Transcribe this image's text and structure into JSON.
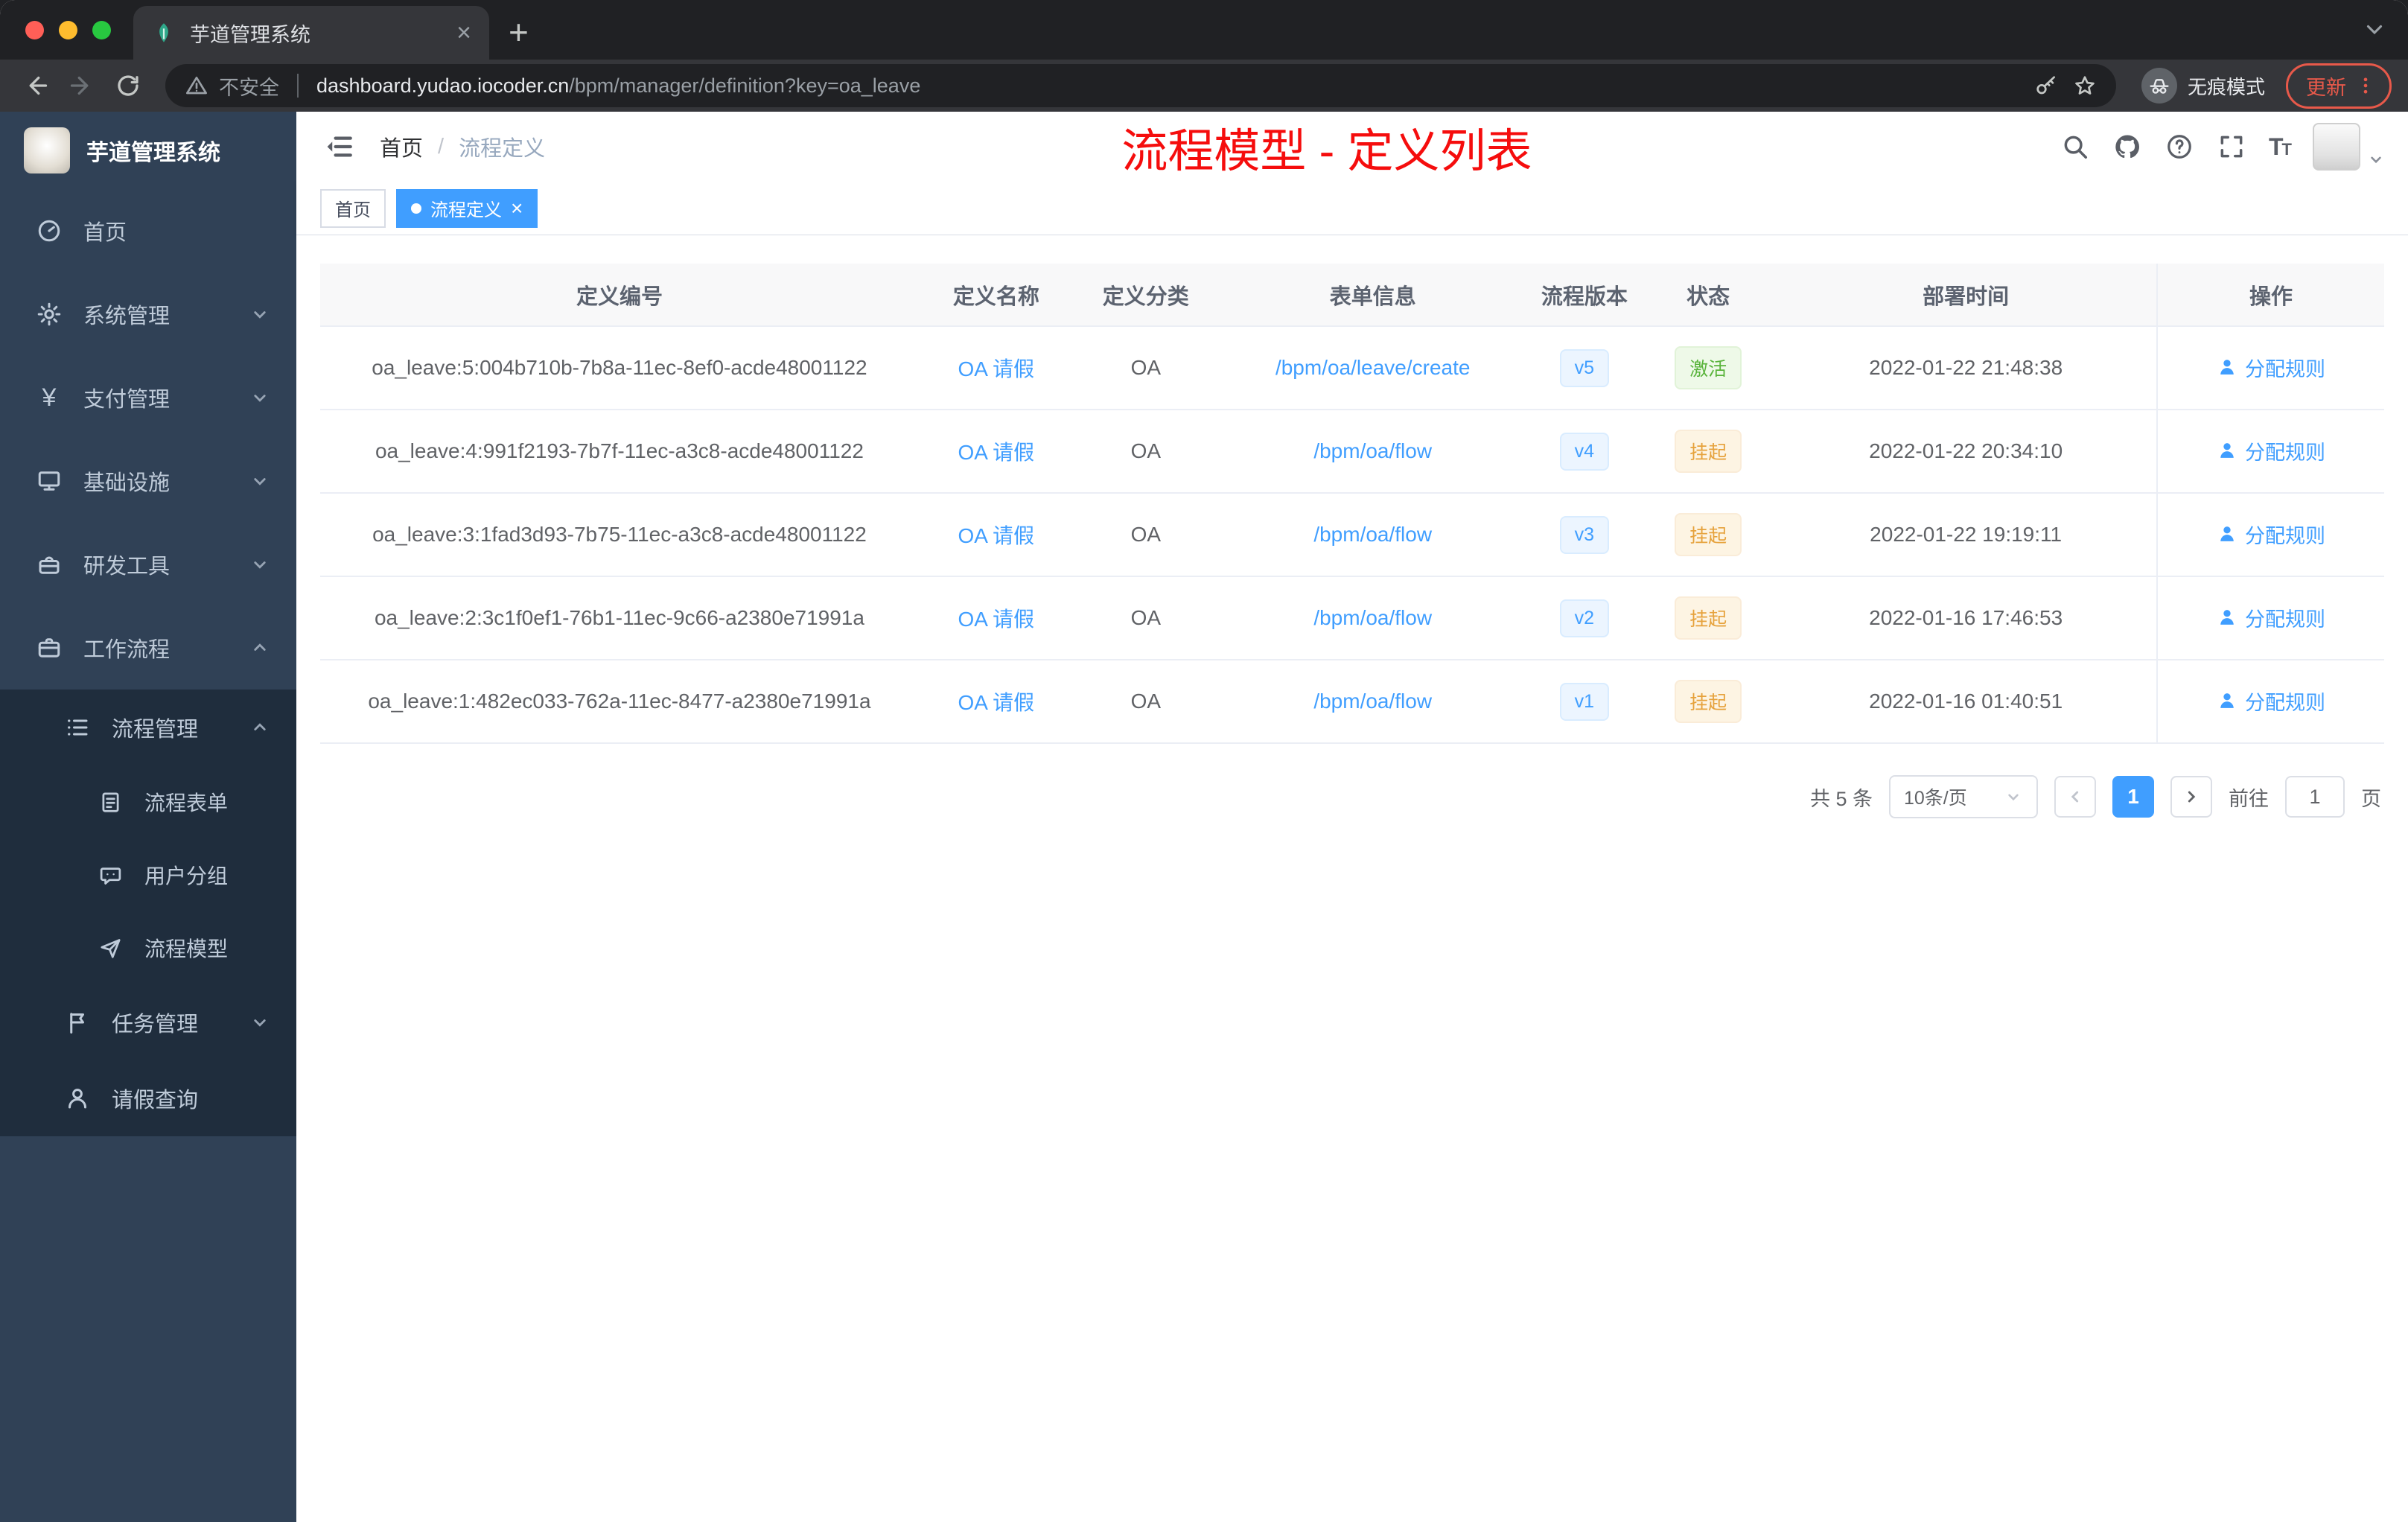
{
  "browser": {
    "tab_title": "芋道管理系统",
    "security_label": "不安全",
    "url_host": "dashboard.yudao.iocoder.cn",
    "url_path": "/bpm/manager/definition?key=oa_leave",
    "incognito_label": "无痕模式",
    "update_label": "更新"
  },
  "sidebar": {
    "title": "芋道管理系统",
    "menu": [
      {
        "label": "首页"
      },
      {
        "label": "系统管理"
      },
      {
        "label": "支付管理"
      },
      {
        "label": "基础设施"
      },
      {
        "label": "研发工具"
      },
      {
        "label": "工作流程"
      }
    ],
    "workflow": {
      "process_mgmt": {
        "label": "流程管理",
        "children": [
          {
            "label": "流程表单"
          },
          {
            "label": "用户分组"
          },
          {
            "label": "流程模型"
          }
        ]
      },
      "task_mgmt": {
        "label": "任务管理"
      },
      "leave_query": {
        "label": "请假查询"
      }
    },
    "yen_glyph": "¥"
  },
  "header": {
    "breadcrumb": [
      "首页",
      "流程定义"
    ],
    "overlay_title": "流程模型 - 定义列表"
  },
  "tags": [
    {
      "label": "首页",
      "active": false
    },
    {
      "label": "流程定义",
      "active": true
    }
  ],
  "table": {
    "headers": [
      "定义编号",
      "定义名称",
      "定义分类",
      "表单信息",
      "流程版本",
      "状态",
      "部署时间",
      "操作"
    ],
    "rows": [
      {
        "id": "oa_leave:5:004b710b-7b8a-11ec-8ef0-acde48001122",
        "name": "OA 请假",
        "category": "OA",
        "form": "/bpm/oa/leave/create",
        "version": "v5",
        "status": "激活",
        "deploy_time": "2022-01-22 21:48:38",
        "action": "分配规则"
      },
      {
        "id": "oa_leave:4:991f2193-7b7f-11ec-a3c8-acde48001122",
        "name": "OA 请假",
        "category": "OA",
        "form": "/bpm/oa/flow",
        "version": "v4",
        "status": "挂起",
        "deploy_time": "2022-01-22 20:34:10",
        "action": "分配规则"
      },
      {
        "id": "oa_leave:3:1fad3d93-7b75-11ec-a3c8-acde48001122",
        "name": "OA 请假",
        "category": "OA",
        "form": "/bpm/oa/flow",
        "version": "v3",
        "status": "挂起",
        "deploy_time": "2022-01-22 19:19:11",
        "action": "分配规则"
      },
      {
        "id": "oa_leave:2:3c1f0ef1-76b1-11ec-9c66-a2380e71991a",
        "name": "OA 请假",
        "category": "OA",
        "form": "/bpm/oa/flow",
        "version": "v2",
        "status": "挂起",
        "deploy_time": "2022-01-16 17:46:53",
        "action": "分配规则"
      },
      {
        "id": "oa_leave:1:482ec033-762a-11ec-8477-a2380e71991a",
        "name": "OA 请假",
        "category": "OA",
        "form": "/bpm/oa/flow",
        "version": "v1",
        "status": "挂起",
        "deploy_time": "2022-01-16 01:40:51",
        "action": "分配规则"
      }
    ]
  },
  "pagination": {
    "total": "共 5 条",
    "page_size": "10条/页",
    "current_page": "1",
    "goto_label": "前往",
    "goto_value": "1",
    "goto_unit": "页"
  },
  "colors": {
    "accent_blue": "#409eff",
    "success_green": "#67c23a",
    "warning_orange": "#e6a23c",
    "annotation_red": "#f50d0d",
    "sidebar_bg": "#304156",
    "submenu_bg": "#1f2d3d"
  }
}
